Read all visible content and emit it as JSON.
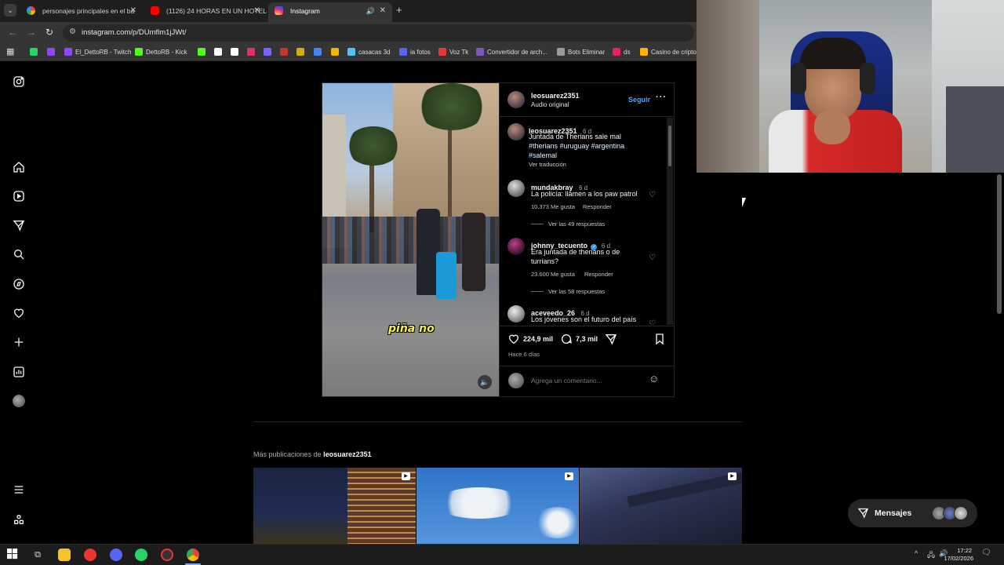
{
  "browser": {
    "tabs": [
      {
        "title": "personajes principales en el ba",
        "favicon": "google-icon",
        "active": false
      },
      {
        "title": "(1126) 24 HORAS EN UN HOTEL",
        "favicon": "youtube-icon",
        "active": false
      },
      {
        "title": "Instagram",
        "favicon": "instagram-icon",
        "active": true
      }
    ],
    "url": "instagram.com/p/DUmflm1jJWt/",
    "bookmarks": [
      {
        "label": "",
        "icon": "whatsapp-icon",
        "color": "#25d366"
      },
      {
        "label": "",
        "icon": "twitch-icon",
        "color": "#9146ff"
      },
      {
        "label": "El_DettoRB - Twitch",
        "icon": "twitch-icon",
        "color": "#9146ff"
      },
      {
        "label": "DettoRB - Kick",
        "icon": "kick-icon",
        "color": "#53fc18"
      },
      {
        "label": "",
        "icon": "kick-icon",
        "color": "#53fc18"
      },
      {
        "label": "",
        "icon": "tiktok-icon",
        "color": "#ffffff"
      },
      {
        "label": "",
        "icon": "x-icon",
        "color": "#ffffff"
      },
      {
        "label": "",
        "icon": "instagram-icon",
        "color": "#e1306c"
      },
      {
        "label": "",
        "icon": "c-icon",
        "color": "#7b61ff"
      },
      {
        "label": "",
        "icon": "dot-icon",
        "color": "#c0392b"
      },
      {
        "label": "",
        "icon": "leaf-icon",
        "color": "#d4ac0d"
      },
      {
        "label": "",
        "icon": "puzzle-icon",
        "color": "#4285f4"
      },
      {
        "label": "",
        "icon": "folder-icon",
        "color": "#f4b400"
      },
      {
        "label": "casacas 3d",
        "icon": "casacas-icon",
        "color": "#4fc3f7"
      },
      {
        "label": "ia fotos",
        "icon": "ia-icon",
        "color": "#5865f2"
      },
      {
        "label": "Voz Tk",
        "icon": "voz-icon",
        "color": "#e53935"
      },
      {
        "label": "Convertidor de arch...",
        "icon": "convert-icon",
        "color": "#7e57c2"
      },
      {
        "label": "Bots Eliminar",
        "icon": "bots-icon",
        "color": "#999999"
      },
      {
        "label": "ds",
        "icon": "ds-icon",
        "color": "#e91e63"
      },
      {
        "label": "Casino de cripto",
        "icon": "casino-icon",
        "color": "#ffb300"
      }
    ]
  },
  "post": {
    "author": "leosuarez2351",
    "audio": "Audio original",
    "follow": "Seguir",
    "caption": {
      "user": "leosuarez2351",
      "age": "6 d",
      "text": "Juntada de Therians sale mal",
      "tags_line1": "#therians #uruguay #argentina",
      "tags_line2": "#salemal",
      "translate": "Ver traducción"
    },
    "comments": [
      {
        "user": "mundakbray",
        "age": "6 d",
        "text1": "La policía: llamen a los paw patrol",
        "text2": "",
        "likes": "10.373 Me gusta",
        "reply": "Responder",
        "replies": "Ver las 49 respuestas"
      },
      {
        "user": "johnny_tecuento",
        "age": "6 d",
        "text1": "Era juntada de therians o de",
        "text2": "turrians?",
        "likes": "23.600 Me gusta",
        "reply": "Responder",
        "replies": "Ver las 58 respuestas"
      },
      {
        "user": "aceveedo_26",
        "age": "6 d",
        "text1": "Los jóvenes son el futuro del país",
        "text2": ""
      }
    ],
    "like_count": "224,9 mil",
    "comment_count": "7,3 mil",
    "posted": "Hace 6 días",
    "comment_placeholder": "Agrega un comentario...",
    "video_caption": "piña no"
  },
  "more_posts": {
    "prefix": "Más publicaciones de",
    "user": "leosuarez2351"
  },
  "messages": {
    "label": "Mensajes"
  },
  "taskbar": {
    "time": "17:22",
    "date": "17/02/2026"
  }
}
